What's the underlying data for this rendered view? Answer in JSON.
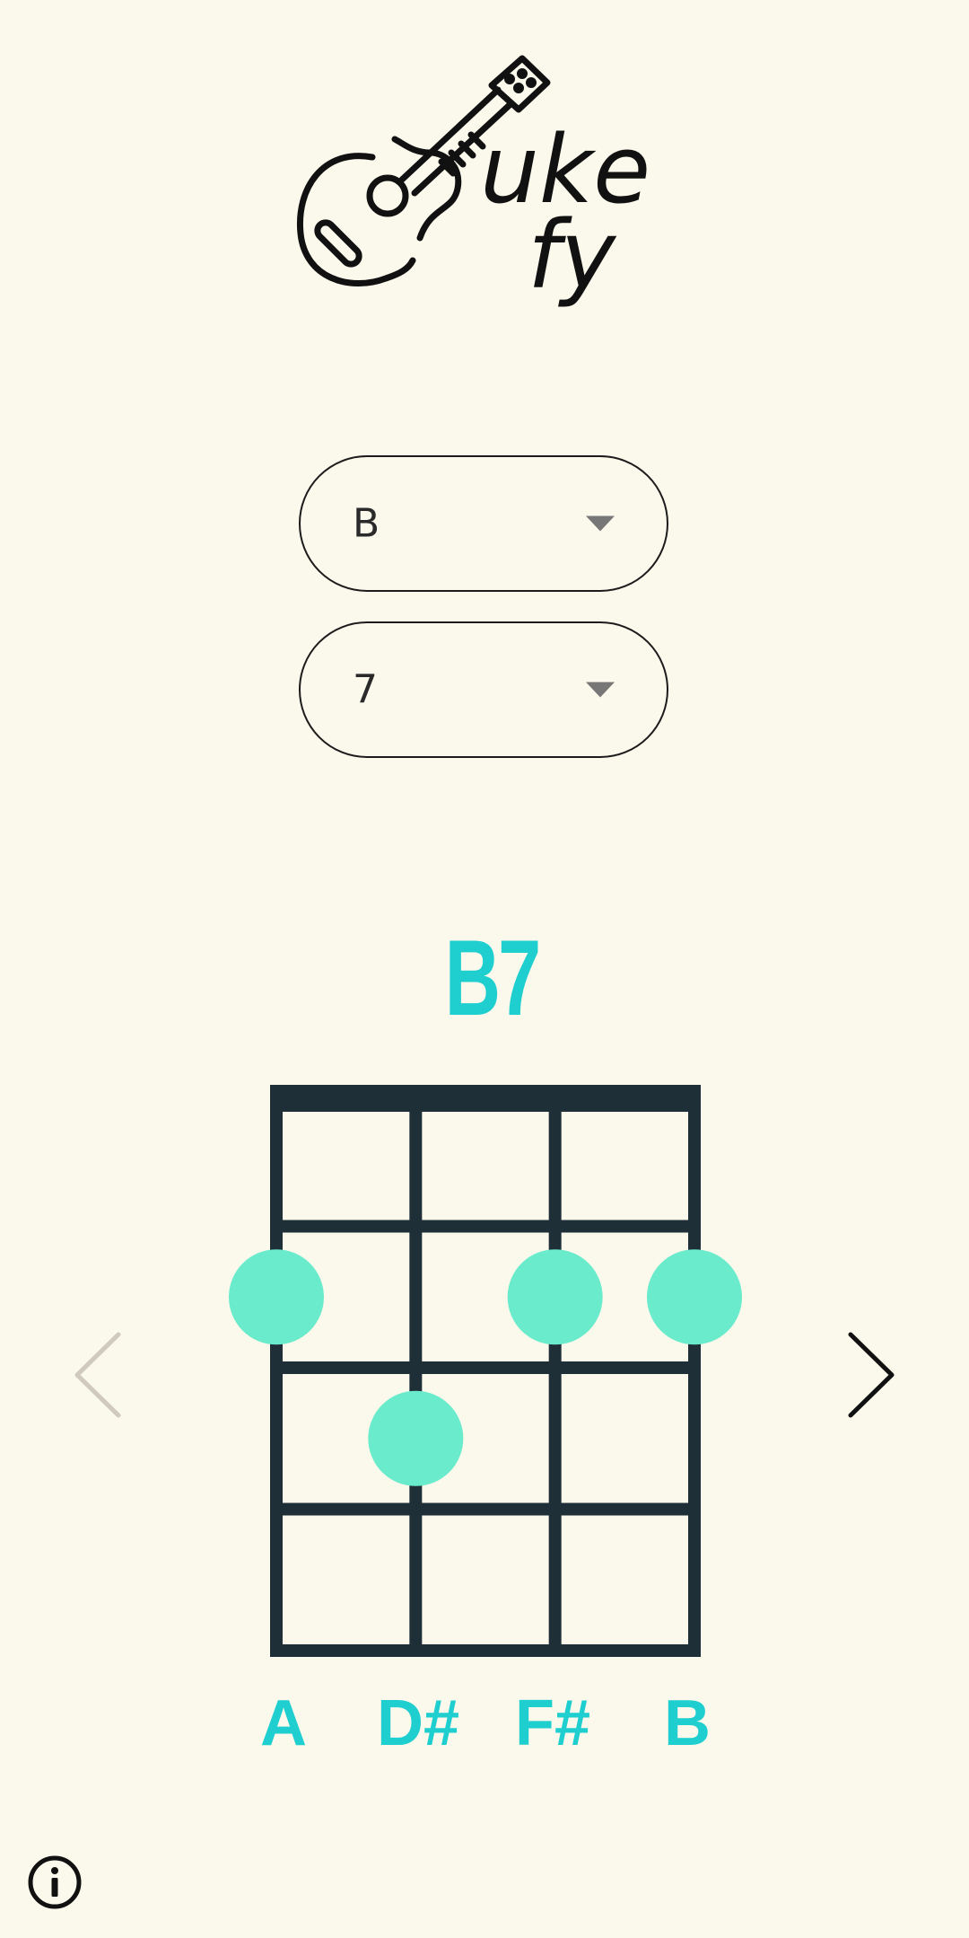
{
  "app": {
    "logo_text_line1": "uke",
    "logo_text_line2": "fy"
  },
  "selectors": {
    "root_value": "B",
    "type_value": "7"
  },
  "chord": {
    "name": "B7",
    "strings": [
      "A",
      "D#",
      "F#",
      "B"
    ],
    "frets_shown": 4,
    "fingering": [
      {
        "string": 1,
        "fret": 2
      },
      {
        "string": 2,
        "fret": 3
      },
      {
        "string": 3,
        "fret": 2
      },
      {
        "string": 4,
        "fret": 2
      }
    ]
  },
  "colors": {
    "background": "#fbf8ec",
    "accent": "#1fcfd0",
    "dot": "#69ebcc",
    "fretboard": "#1f2f38",
    "nav_prev": "#cfcabd",
    "nav_next": "#111111"
  },
  "icons": {
    "logo": "ukulele-icon",
    "prev": "chevron-left-icon",
    "next": "chevron-right-icon",
    "info": "info-icon",
    "dropdown": "caret-down-icon"
  }
}
